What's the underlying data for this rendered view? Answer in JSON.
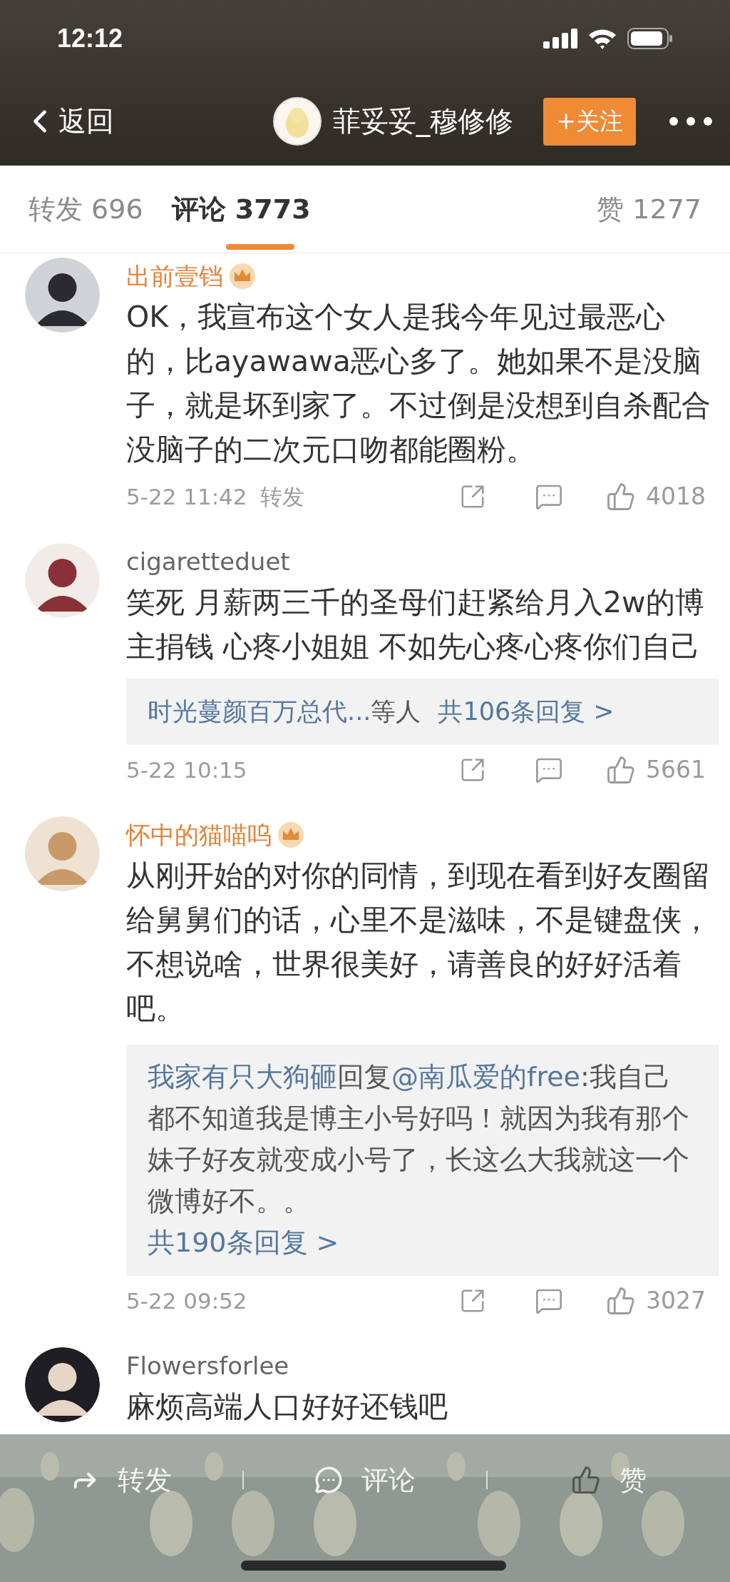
{
  "status_bar": {
    "time": "12:12"
  },
  "nav": {
    "back": "返回",
    "title": "菲妥妥_穆修修",
    "follow": "+关注"
  },
  "tabs": [
    {
      "label": "转发 696",
      "selected": false
    },
    {
      "label": "评论 3773",
      "selected": true
    },
    {
      "label": "赞 1277",
      "selected": false
    }
  ],
  "comments": [
    {
      "name": "出前壹铛",
      "vip": true,
      "text": "OK，我宣布这个女人是我今年见过最恶心的，比ayawawa恶心多了。她如果不是没脑子，就是坏到家了。不过倒是没想到自杀配合没脑子的二次元口吻都能圈粉。",
      "time": "5-22 11:42",
      "repost": "转发",
      "likes": "4018"
    },
    {
      "name": "cigaretteduet",
      "vip": false,
      "text": "笑死 月薪两三千的圣母们赶紧给月入2w的博主捐钱 心疼小姐姐 不如先心疼心疼你们自己",
      "replies": {
        "kind": "summary",
        "users": "时光蔓颜百万总代...",
        "suffix": "等人",
        "more": "共106条回复 >"
      },
      "time": "5-22 10:15",
      "likes": "5661"
    },
    {
      "name": "怀中的猫喵呜",
      "vip": true,
      "text": "从刚开始的对你的同情，到现在看到好友圈留给舅舅们的话，心里不是滋味，不是键盘侠，不想说啥，世界很美好，请善良的好好活着吧。",
      "replies": {
        "kind": "thread",
        "user": "我家有只大狗砸",
        "verb": "回复",
        "mention": "@南瓜爱的free",
        "text": ":我自己都不知道我是博主小号好吗！就因为我有那个妹子好友就变成小号了，长这么大我就这一个微博好不。。",
        "more": "共190条回复 >"
      },
      "time": "5-22 09:52",
      "likes": "3027"
    },
    {
      "name": "Flowersforlee",
      "vip": false,
      "text": "麻烦高端人口好好还钱吧"
    }
  ],
  "actions": [
    {
      "kind": "repost",
      "label": "转发"
    },
    {
      "kind": "comment",
      "label": "评论"
    },
    {
      "kind": "like",
      "label": "赞"
    }
  ]
}
